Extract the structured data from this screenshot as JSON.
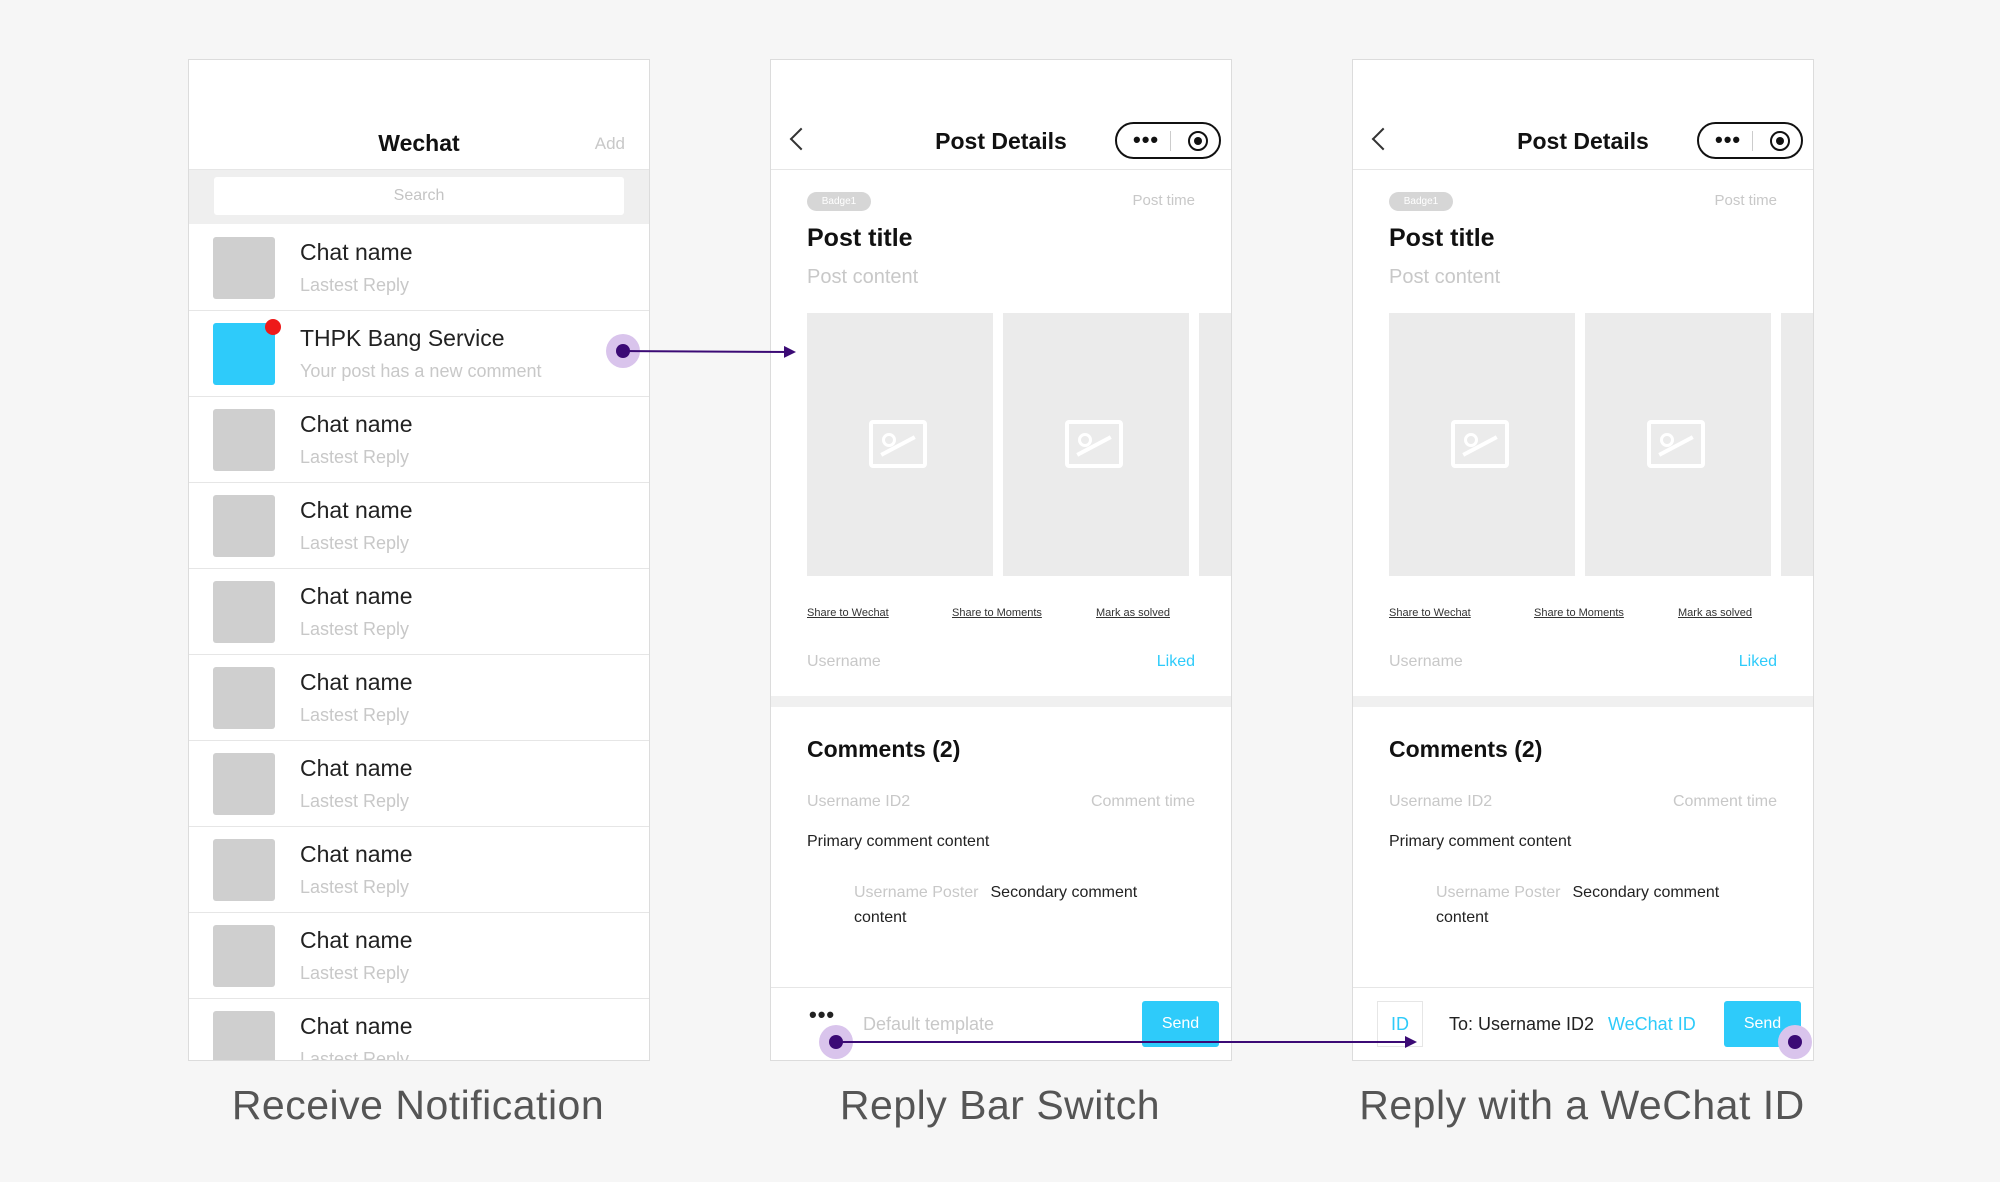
{
  "colors": {
    "accent": "#2ecbfa",
    "notification_dot": "#ee1a1a",
    "connector": "#3b0a75",
    "connector_halo": "#d9c4ec"
  },
  "screen1": {
    "title": "Wechat",
    "add_label": "Add",
    "search_placeholder": "Search",
    "chats": [
      {
        "name": "Chat name",
        "reply": "Lastest Reply"
      },
      {
        "name": "THPK Bang Service",
        "reply": "Your post has a new comment",
        "highlighted": true,
        "unread": true
      },
      {
        "name": "Chat name",
        "reply": "Lastest Reply"
      },
      {
        "name": "Chat name",
        "reply": "Lastest Reply"
      },
      {
        "name": "Chat name",
        "reply": "Lastest Reply"
      },
      {
        "name": "Chat name",
        "reply": "Lastest Reply"
      },
      {
        "name": "Chat name",
        "reply": "Lastest Reply"
      },
      {
        "name": "Chat name",
        "reply": "Lastest Reply"
      },
      {
        "name": "Chat name",
        "reply": "Lastest Reply"
      },
      {
        "name": "Chat name",
        "reply": "Lastest Reply"
      }
    ],
    "caption": "Receive Notification"
  },
  "detail": {
    "title": "Post Details",
    "badge": "Badge1",
    "post_time": "Post time",
    "post_title": "Post title",
    "post_content": "Post content",
    "share_wechat": "Share to Wechat",
    "share_moments": "Share to Moments",
    "mark_solved": "Mark as solved",
    "username": "Username",
    "liked": "Liked",
    "comments_title": "Comments (2)",
    "comment_user": "Username ID2",
    "comment_time": "Comment time",
    "primary_comment": "Primary comment content",
    "secondary_poster": "Username Poster",
    "secondary_comment": "Secondary comment content",
    "send_label": "Send"
  },
  "screen2": {
    "reply_placeholder": "Default template",
    "caption": "Reply Bar Switch"
  },
  "screen3": {
    "id_button": "ID",
    "reply_to": "To: Username ID2",
    "wechat_id": "WeChat ID",
    "caption": "Reply with a WeChat ID"
  }
}
